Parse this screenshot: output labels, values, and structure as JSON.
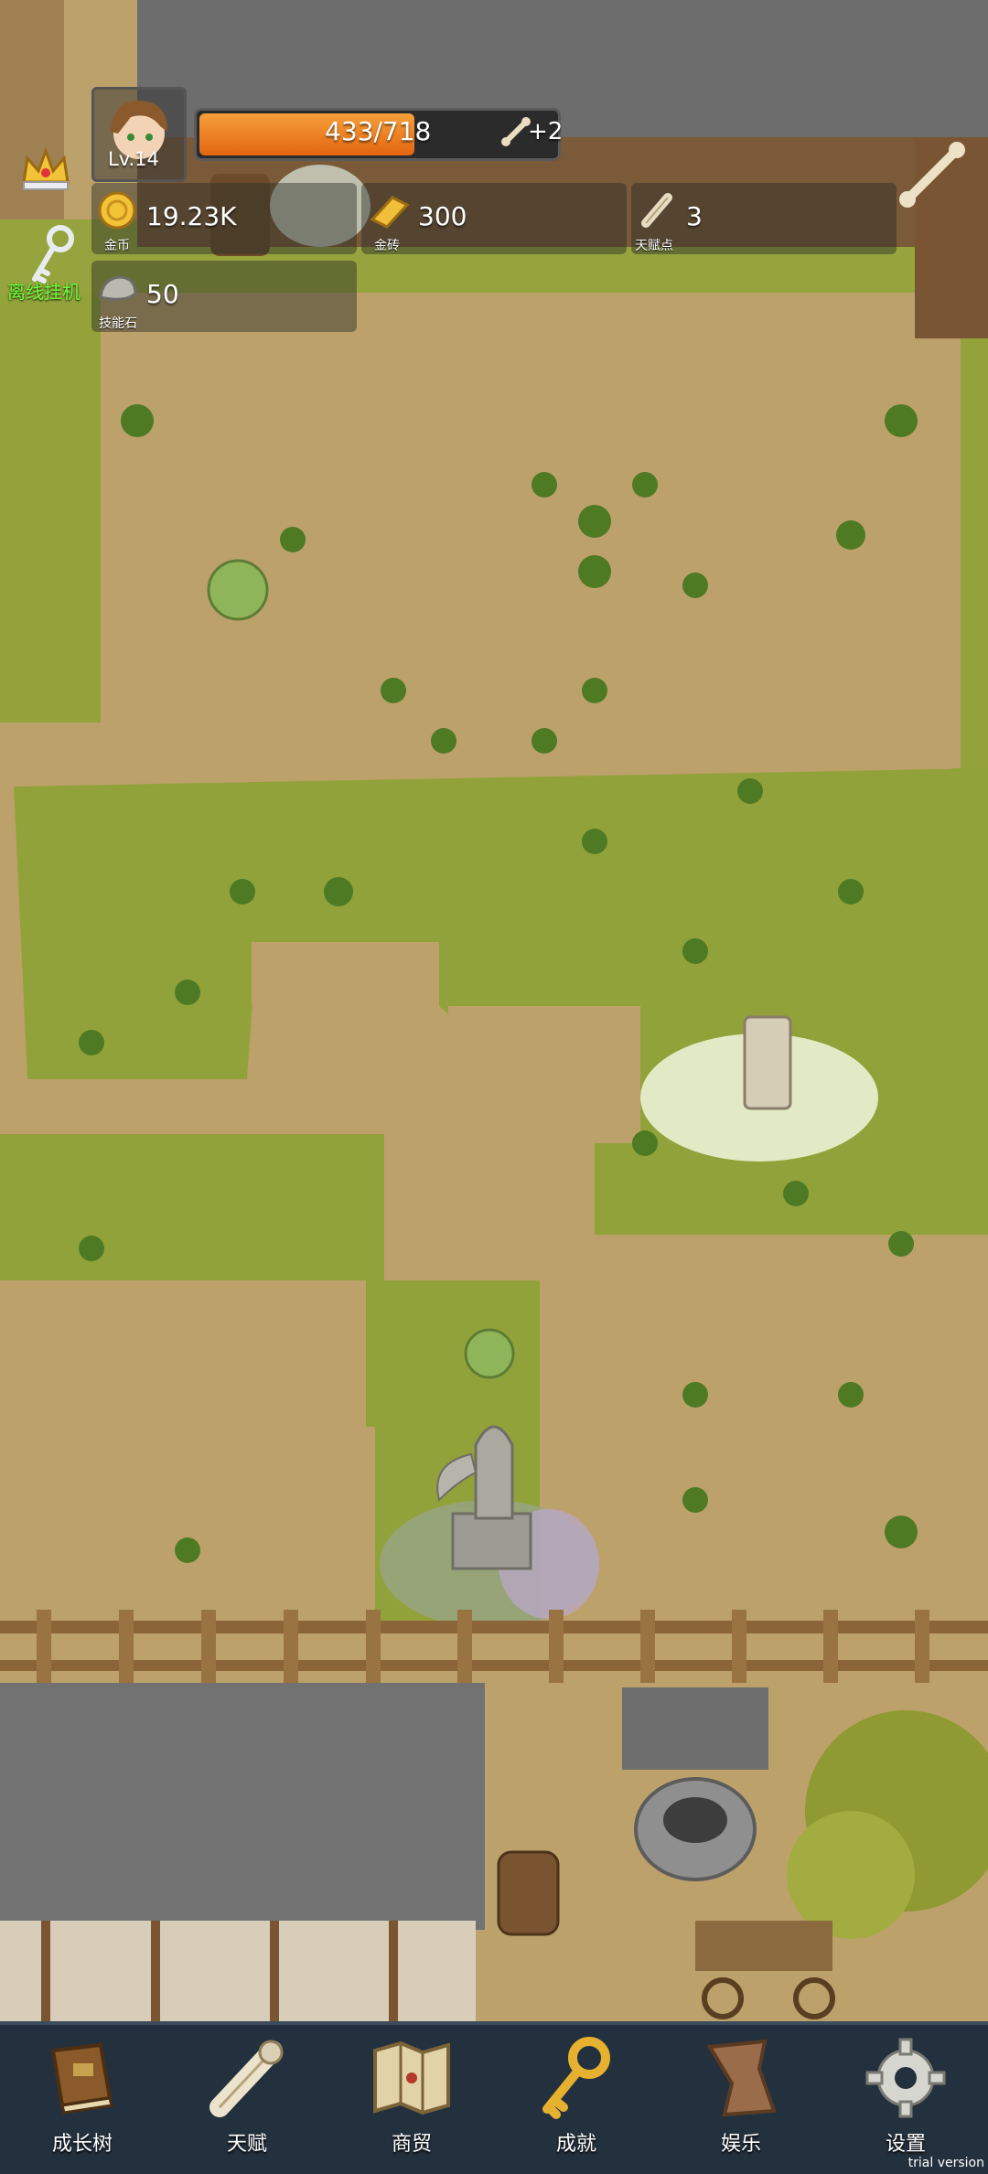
{
  "player": {
    "level": "Lv.14",
    "xp_text": "433/718",
    "xp_progress": 0.603,
    "xp_bonus": "+2"
  },
  "resources": {
    "gold": {
      "value": "19.23K",
      "label": "金币"
    },
    "gold_brick": {
      "value": "300",
      "label": "金砖"
    },
    "talent_points": {
      "value": "3",
      "label": "天赋点"
    },
    "skill_stone": {
      "value": "50",
      "label": "技能石"
    }
  },
  "side": {
    "idle_label": "离线挂机"
  },
  "nav": [
    {
      "label": "成长树",
      "icon": "book-icon"
    },
    {
      "label": "天赋",
      "icon": "scroll-icon"
    },
    {
      "label": "商贸",
      "icon": "map-icon"
    },
    {
      "label": "成就",
      "icon": "key-icon"
    },
    {
      "label": "娱乐",
      "icon": "banner-icon"
    },
    {
      "label": "设置",
      "icon": "gear-icon"
    }
  ],
  "watermark": "trial version",
  "colors": {
    "xp_bar": "#f07a1e",
    "grass": "#8fa13a",
    "dirt": "#bba06a",
    "nav_bg": "#23303d"
  }
}
